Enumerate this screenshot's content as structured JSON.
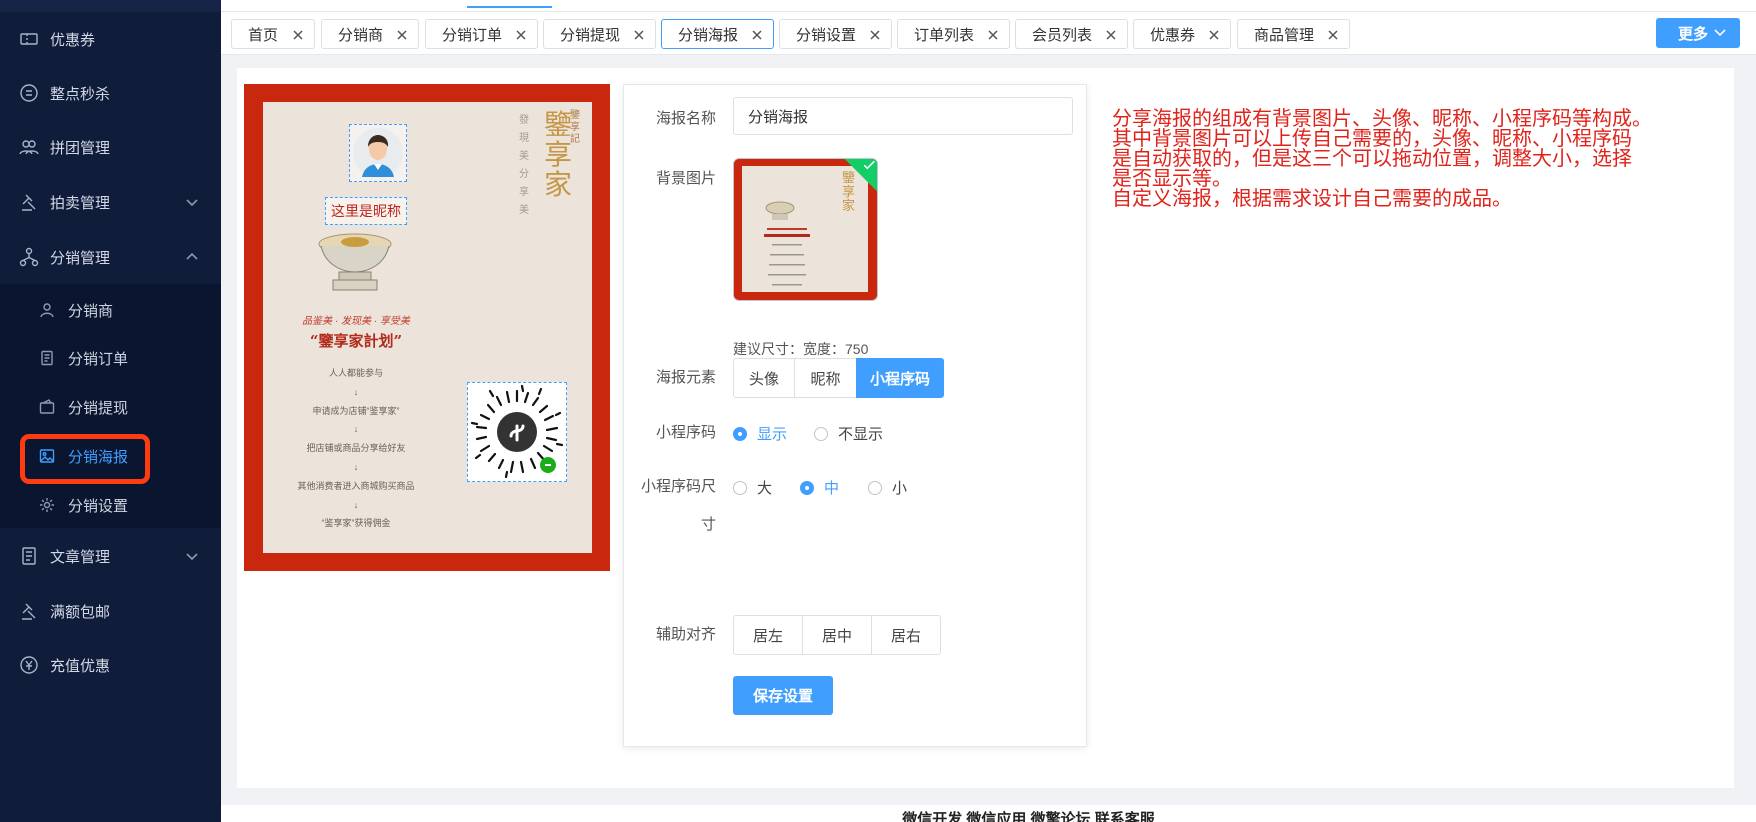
{
  "sidebar": {
    "items": [
      {
        "label": "优惠券",
        "icon": "coupon-icon"
      },
      {
        "label": "整点秒杀",
        "icon": "flash-sale-icon"
      },
      {
        "label": "拼团管理",
        "icon": "group-buy-icon"
      },
      {
        "label": "拍卖管理",
        "icon": "auction-icon"
      },
      {
        "label": "分销管理",
        "icon": "distribution-icon"
      },
      {
        "label": "文章管理",
        "icon": "article-icon"
      },
      {
        "label": "满额包邮",
        "icon": "free-shipping-icon"
      },
      {
        "label": "充值优惠",
        "icon": "recharge-icon"
      }
    ],
    "submenu": [
      {
        "label": "分销商",
        "icon": "user-icon"
      },
      {
        "label": "分销订单",
        "icon": "order-icon"
      },
      {
        "label": "分销提现",
        "icon": "wallet-icon"
      },
      {
        "label": "分销海报",
        "icon": "image-icon"
      },
      {
        "label": "分销设置",
        "icon": "gear-icon"
      }
    ],
    "active_sub": "分销海报"
  },
  "tabs": [
    {
      "label": "首页"
    },
    {
      "label": "分销商"
    },
    {
      "label": "分销订单"
    },
    {
      "label": "分销提现"
    },
    {
      "label": "分销海报"
    },
    {
      "label": "分销设置"
    },
    {
      "label": "订单列表"
    },
    {
      "label": "会员列表"
    },
    {
      "label": "优惠券"
    },
    {
      "label": "商品管理"
    }
  ],
  "active_tab": "分销海报",
  "more_label": "更多",
  "poster": {
    "nickname": "这里是昵称",
    "title": "鑒享家",
    "tag": "鑒享記",
    "subtitle": "發現美分享美",
    "slogan": "品鉴美 · 发现美 · 享受美",
    "plan": "“鑒享家計划”",
    "steps": [
      "人人都能参与",
      "↓",
      "申请成为店铺“鉴享家”",
      "↓",
      "把店铺或商品分享给好友",
      "↓",
      "其他消费者进入商城购买商品",
      "↓",
      "“鉴享家”获得佣金"
    ]
  },
  "form": {
    "name_label": "海报名称",
    "name_value": "分销海报",
    "bg_label": "背景图片",
    "size_hint": "建议尺寸：宽度：750",
    "elements_label": "海报元素",
    "elements": [
      "头像",
      "昵称",
      "小程序码"
    ],
    "elements_selected": "小程序码",
    "qr_label": "小程序码",
    "qr_options": [
      "显示",
      "不显示"
    ],
    "qr_selected": "显示",
    "qr_size_label_1": "小程序码尺",
    "qr_size_label_2": "寸",
    "qr_sizes": [
      "大",
      "中",
      "小"
    ],
    "qr_size_selected": "中",
    "align_label": "辅助对齐",
    "aligns": [
      "居左",
      "居中",
      "居右"
    ],
    "save": "保存设置"
  },
  "annotation": [
    "分享海报的组成有背景图片、头像、昵称、小程序码等构成。",
    "其中背景图片可以上传自己需要的，头像、昵称、小程序码",
    "是自动获取的，但是这三个可以拖动位置，调整大小，选择",
    "是否显示等。",
    "自定义海报，根据需求设计自己需要的成品。"
  ],
  "footer": "微信开发 微信应用 微擎论坛 联系客服",
  "colors": {
    "accent": "#409eff",
    "sidebar": "#0f1c3a",
    "highlight": "#ff3b12",
    "annotation": "#e1221a"
  }
}
